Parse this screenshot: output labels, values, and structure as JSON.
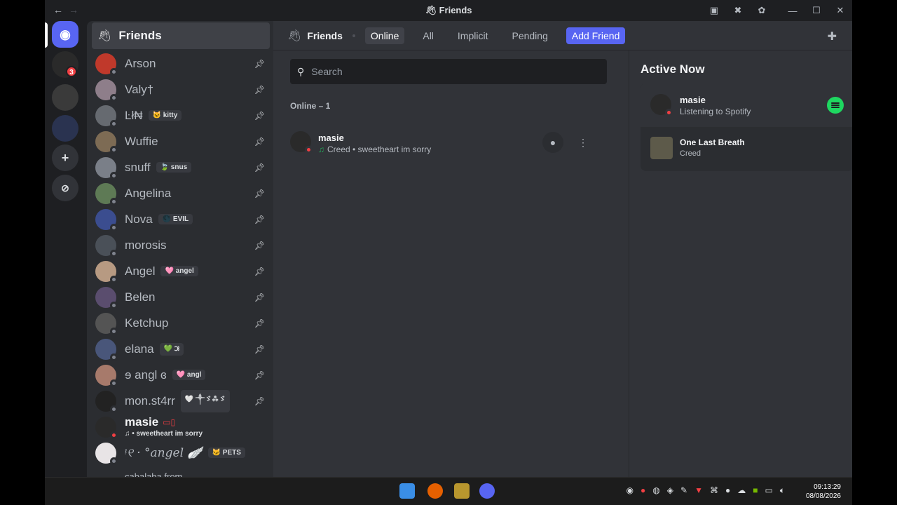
{
  "window": {
    "title": "Friends",
    "controls": {
      "minimize": "—",
      "maximize": "☐",
      "close": "✕"
    }
  },
  "rail": {
    "badge": "3"
  },
  "sidebar": {
    "header": "Friends",
    "dms": [
      {
        "name": "Arson",
        "tag": "",
        "color": "#c0392b"
      },
      {
        "name": "Valy†",
        "tag": "",
        "color": "#8e7e8a"
      },
      {
        "name": "Ŀł₦",
        "tag": "🐱 kitty",
        "color": "#666a70"
      },
      {
        "name": "Wuffie",
        "tag": "",
        "color": "#7d6b54"
      },
      {
        "name": "snuff",
        "tag": "🍃 snus",
        "color": "#7a7f88"
      },
      {
        "name": "Angelina",
        "tag": "",
        "color": "#5e7a55"
      },
      {
        "name": "Nova",
        "tag": "🌑 EVIL",
        "color": "#3b4d8f"
      },
      {
        "name": "morosis",
        "tag": "",
        "color": "#4a5058"
      },
      {
        "name": "Angel",
        "tag": "🩷 angel",
        "color": "#b79a82"
      },
      {
        "name": "Belen",
        "tag": "",
        "color": "#5a4d6e"
      },
      {
        "name": "Ketchup",
        "tag": "",
        "color": "#545454"
      },
      {
        "name": "elana",
        "tag": "💚 ౫",
        "color": "#49567a"
      },
      {
        "name": "ɘ angl ɞ",
        "tag": "🩷 angl",
        "color": "#a77a6b"
      },
      {
        "name": "mon.st4rr",
        "tag": "🤍 ༒ゞ⁂ゞ",
        "color": "#222"
      }
    ],
    "active_dm": {
      "name": "masie",
      "status": "♫ • sweetheart im sorry"
    },
    "last_dm": {
      "name": "ᵎ୧ · °angel 🪽",
      "tag": "🐱 PETS"
    },
    "cutoff": "cabalaba.from"
  },
  "main": {
    "title": "Friends",
    "tabs": [
      "Online",
      "All",
      "Implicit",
      "Pending"
    ],
    "add_friend": "Add Friend",
    "search_placeholder": "Search",
    "online_header": "Online – 1",
    "friend": {
      "name": "masie",
      "status": "Creed • sweetheart im sorry"
    }
  },
  "active_now": {
    "title": "Active Now",
    "user": "masie",
    "activity": "Listening to Spotify",
    "song": "One Last Breath",
    "artist": "Creed"
  },
  "taskbar": {
    "time": "09:13:29",
    "date": "08/08/2026"
  },
  "colors": {
    "blurple": "#5865f2",
    "spotify": "#1ed760",
    "online_red": "#f23f43"
  }
}
